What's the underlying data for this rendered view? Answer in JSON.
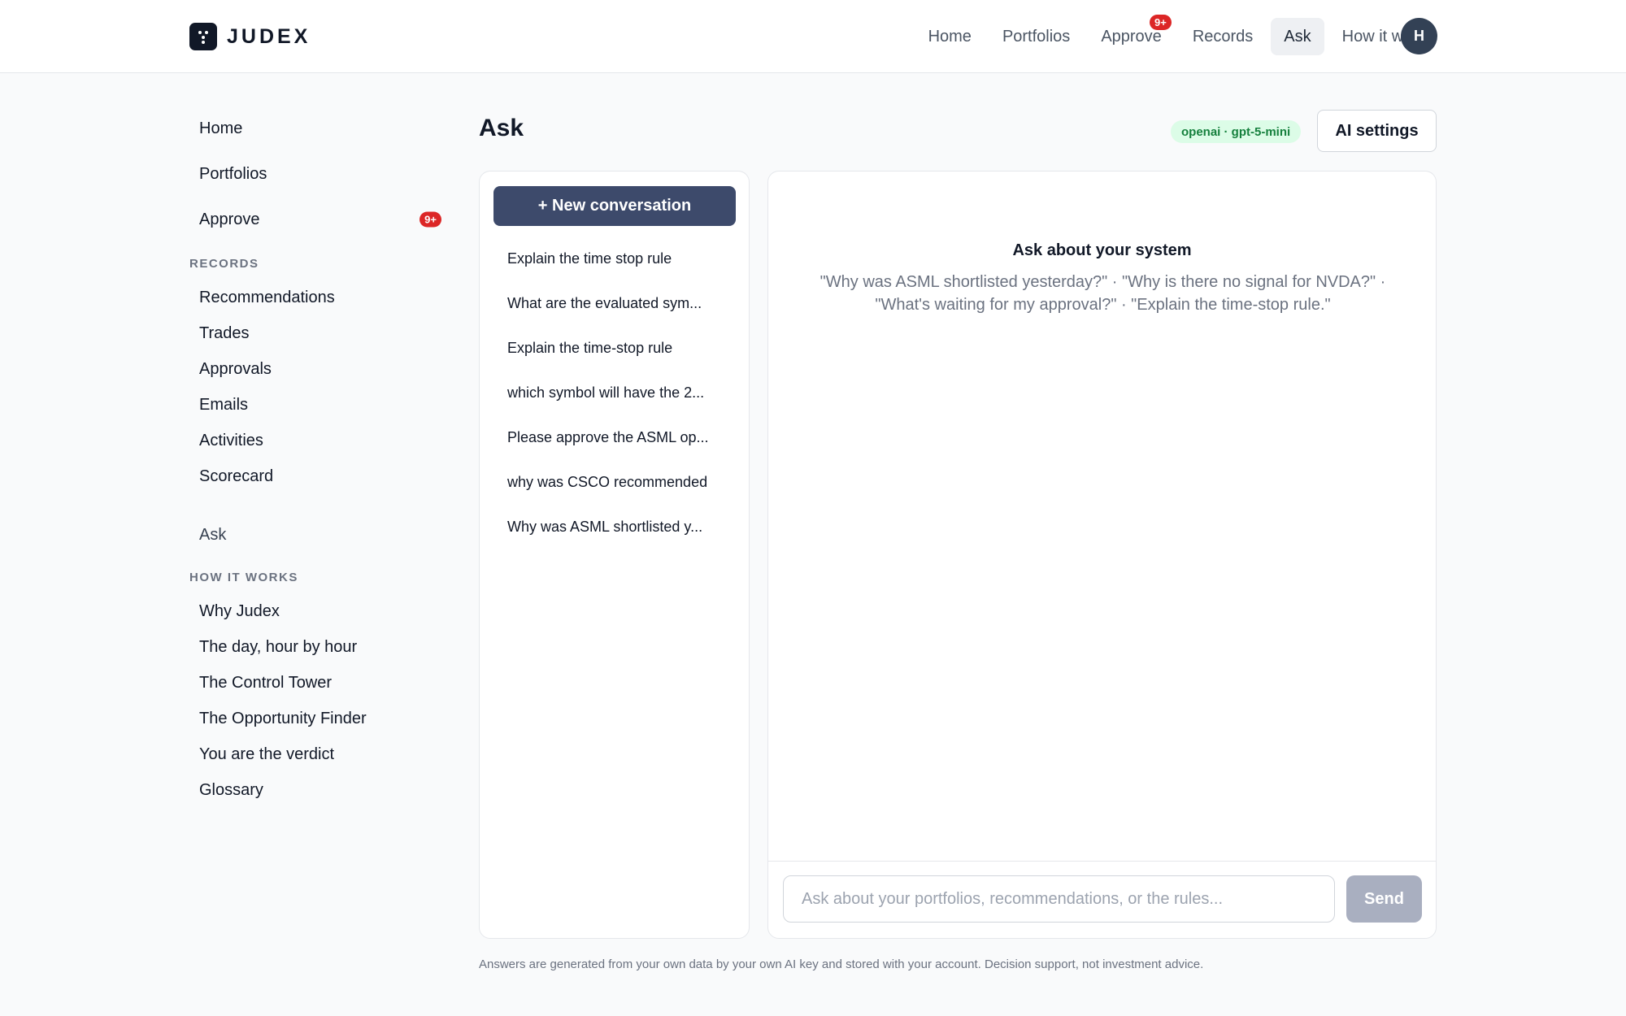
{
  "brand": {
    "name": "JUDEX",
    "logo_icon": "dots-logo-icon"
  },
  "topnav": {
    "items": [
      {
        "label": "Home"
      },
      {
        "label": "Portfolios"
      },
      {
        "label": "Approve",
        "badge": "9+"
      },
      {
        "label": "Records"
      },
      {
        "label": "Ask",
        "active": true
      },
      {
        "label": "How it works"
      }
    ],
    "avatar_initial": "H"
  },
  "sidebar": {
    "top_items": [
      {
        "label": "Home"
      },
      {
        "label": "Portfolios"
      },
      {
        "label": "Approve",
        "badge": "9+"
      }
    ],
    "records_heading": "RECORDS",
    "records_items": [
      {
        "label": "Recommendations"
      },
      {
        "label": "Trades"
      },
      {
        "label": "Approvals"
      },
      {
        "label": "Emails"
      },
      {
        "label": "Activities"
      },
      {
        "label": "Scorecard"
      }
    ],
    "ask_label": "Ask",
    "how_heading": "HOW IT WORKS",
    "how_items": [
      {
        "label": "Why Judex"
      },
      {
        "label": "The day, hour by hour"
      },
      {
        "label": "The Control Tower"
      },
      {
        "label": "The Opportunity Finder"
      },
      {
        "label": "You are the verdict"
      },
      {
        "label": "Glossary"
      }
    ]
  },
  "main": {
    "title": "Ask",
    "model_pill": "openai · gpt-5-mini",
    "ai_settings_label": "AI settings",
    "new_conversation_label": "+ New conversation",
    "conversations": [
      {
        "label": "Explain the time stop rule"
      },
      {
        "label": "What are the evaluated sym..."
      },
      {
        "label": "Explain the time-stop rule"
      },
      {
        "label": "which symbol will have the 2..."
      },
      {
        "label": "Please approve the ASML op..."
      },
      {
        "label": "why was CSCO recommended"
      },
      {
        "label": "Why was ASML shortlisted y..."
      }
    ],
    "empty_title": "Ask about your system",
    "empty_examples": "\"Why was ASML shortlisted yesterday?\" · \"Why is there no signal for NVDA?\" · \"What's waiting for my approval?\" · \"Explain the time-stop rule.\"",
    "input_placeholder": "Ask about your portfolios, recommendations, or the rules...",
    "send_label": "Send",
    "footer_note": "Answers are generated from your own data by your own AI key and stored with your account. Decision support, not investment advice."
  },
  "colors": {
    "primary": "#3d4a6b",
    "badge": "#dc2626",
    "pill_bg": "#dcfce7",
    "pill_text": "#15803d",
    "send_disabled": "#a9afc0"
  }
}
